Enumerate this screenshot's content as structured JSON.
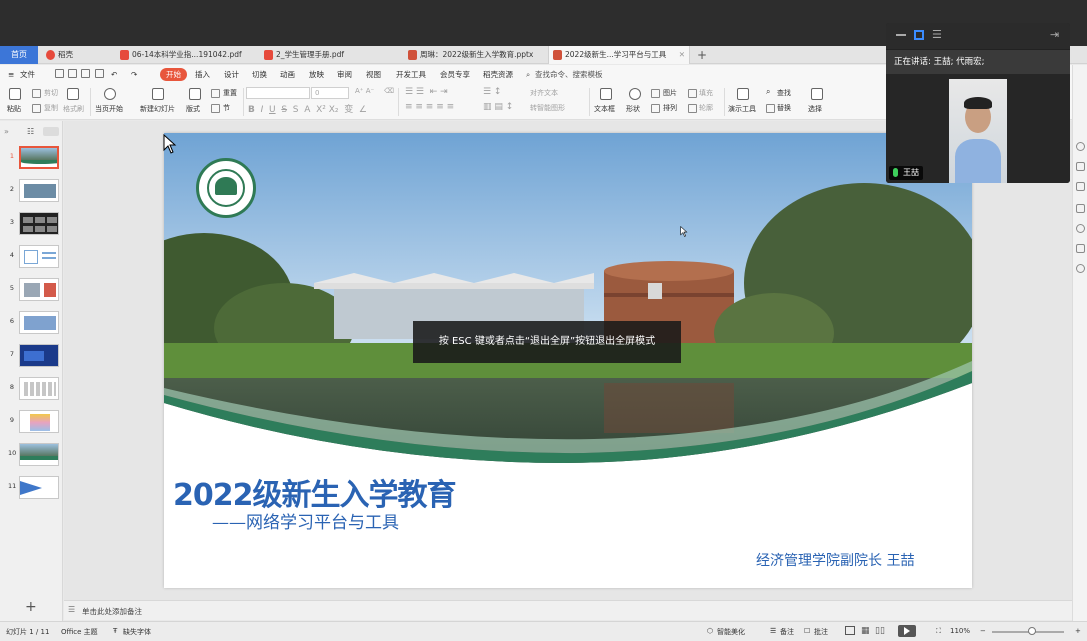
{
  "tabs": {
    "home": "首页",
    "items": [
      {
        "label": "稻壳",
        "icon": "docer-icon",
        "color": "#e64a3c",
        "closable": false
      },
      {
        "label": "06-14本科学业指...191042.pdf",
        "icon": "pdf-icon",
        "color": "#e64a3c",
        "closable": true
      },
      {
        "label": "2_学生管理手册.pdf",
        "icon": "pdf-icon",
        "color": "#e64a3c",
        "closable": true
      },
      {
        "label": "周琳：2022级新生入学教育.pptx",
        "icon": "pptx-icon",
        "color": "#d0513a",
        "closable": true
      },
      {
        "label": "2022级新生...学习平台与工具",
        "icon": "pptx-icon",
        "color": "#d0513a",
        "closable": true
      }
    ],
    "add": "+"
  },
  "menubar": {
    "file": "文件",
    "start": "开始",
    "items": [
      "插入",
      "设计",
      "切换",
      "动画",
      "放映",
      "审阅",
      "视图",
      "开发工具",
      "会员专享",
      "稻壳资源"
    ],
    "search": "查找命令、搜索模板"
  },
  "ribbon": {
    "paste": "粘贴",
    "cut": "剪切",
    "copy": "复制",
    "format_painter": "格式刷",
    "from_current": "当页开始",
    "new_slide": "新建幻灯片",
    "layout": "版式",
    "section": "节",
    "reset": "重置",
    "font_size_value": "0",
    "align_text": "对齐文本",
    "convert_smartart": "转智能图形",
    "textbox": "文本框",
    "shape": "形状",
    "picture": "图片",
    "fill": "填充",
    "arrange": "排列",
    "outline": "轮廓",
    "present_tools": "演示工具",
    "find": "查找",
    "replace": "替换",
    "select": "选择"
  },
  "slides": {
    "count": 11,
    "selected": 1,
    "numbers": [
      "1",
      "2",
      "3",
      "4",
      "5",
      "6",
      "7",
      "8",
      "9",
      "10",
      "11"
    ],
    "add": "+"
  },
  "slide": {
    "title": "2022级新生入学教育",
    "subtitle": "——网络学习平台与工具",
    "author": "经济管理学院副院长  王喆",
    "accent_color": "#2a63b3",
    "wave_color": "#2e7d5b"
  },
  "overlay": {
    "esc_hint": "按 ESC 键或者点击“退出全屏”按钮退出全屏模式"
  },
  "notes": {
    "placeholder": "单击此处添加备注"
  },
  "statusbar": {
    "slide_pos": "幻灯片 1 / 11",
    "theme": "Office 主题",
    "missing_font": "缺失字体",
    "smart_beautify": "智能美化",
    "notes": "备注",
    "comments": "批注",
    "zoom": "110%"
  },
  "meeting": {
    "speaking_label": "正在讲话: 王喆; 代雨宏;",
    "participant_name": "王喆"
  }
}
